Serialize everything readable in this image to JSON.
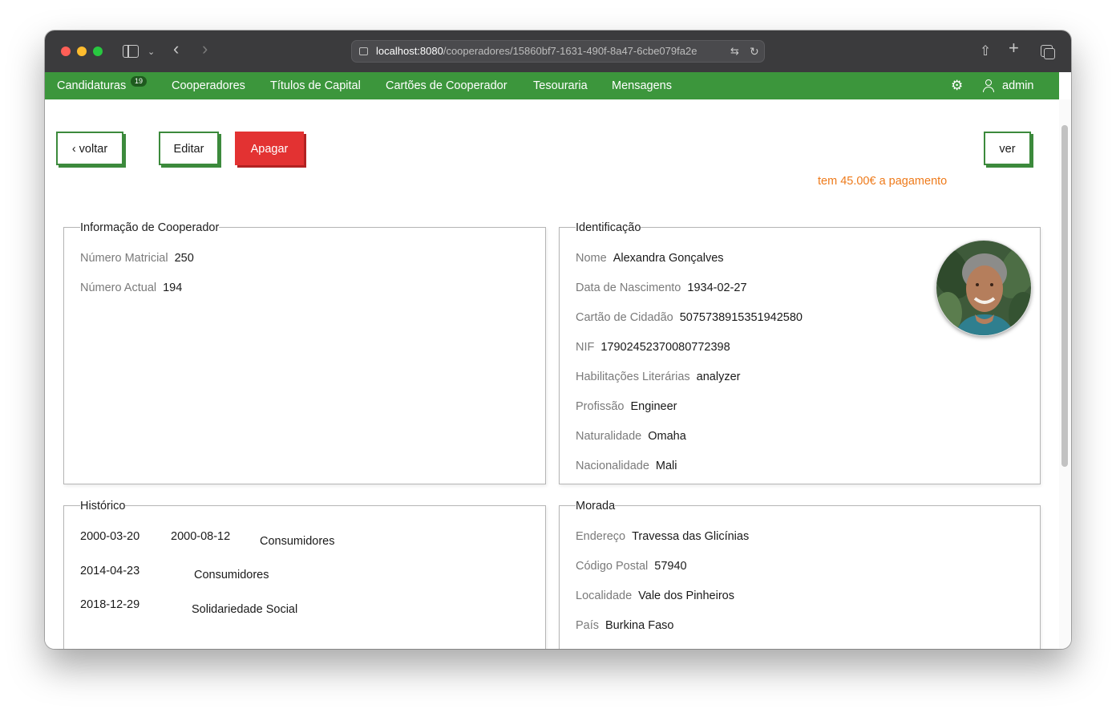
{
  "browser": {
    "url_host": "localhost:8080",
    "url_path": "/cooperadores/15860bf7-1631-490f-8a47-6cbe079fa2e"
  },
  "nav": {
    "items": [
      {
        "label": "Candidaturas",
        "badge": "19"
      },
      {
        "label": "Cooperadores"
      },
      {
        "label": "Títulos de Capital"
      },
      {
        "label": "Cartões de Cooperador"
      },
      {
        "label": "Tesouraria"
      },
      {
        "label": "Mensagens"
      }
    ],
    "user": "admin"
  },
  "actions": {
    "back": "‹ voltar",
    "edit": "Editar",
    "delete": "Apagar",
    "payment_note": "tem 45.00€ a pagamento",
    "view": "ver"
  },
  "info": {
    "title": "Informação de Cooperador",
    "fields": [
      {
        "label": "Número Matricial",
        "value": "250"
      },
      {
        "label": "Número Actual",
        "value": "194"
      }
    ]
  },
  "identification": {
    "title": "Identificação",
    "fields": [
      {
        "label": "Nome",
        "value": "Alexandra Gonçalves"
      },
      {
        "label": "Data de Nascimento",
        "value": "1934-02-27"
      },
      {
        "label": "Cartão de Cidadão",
        "value": "5075738915351942580"
      },
      {
        "label": "NIF",
        "value": "17902452370080772398"
      },
      {
        "label": "Habilitações Literárias",
        "value": "analyzer"
      },
      {
        "label": "Profissão",
        "value": "Engineer"
      },
      {
        "label": "Naturalidade",
        "value": "Omaha"
      },
      {
        "label": "Nacionalidade",
        "value": "Mali"
      }
    ]
  },
  "history": {
    "title": "Histórico",
    "rows": [
      {
        "start": "2000-03-20",
        "end": "2000-08-12",
        "group": "Consumidores"
      },
      {
        "start": "2014-04-23",
        "end": "",
        "group": "Consumidores"
      },
      {
        "start": "2018-12-29",
        "end": "",
        "group": "Solidariedade Social"
      }
    ]
  },
  "address": {
    "title": "Morada",
    "fields": [
      {
        "label": "Endereço",
        "value": "Travessa das Glicínias"
      },
      {
        "label": "Código Postal",
        "value": "57940"
      },
      {
        "label": "Localidade",
        "value": "Vale dos Pinheiros"
      },
      {
        "label": "País",
        "value": "Burkina Faso"
      }
    ]
  },
  "colors": {
    "navbar": "#3c963c",
    "danger": "#e33232",
    "warning_text": "#ee7a1a"
  }
}
